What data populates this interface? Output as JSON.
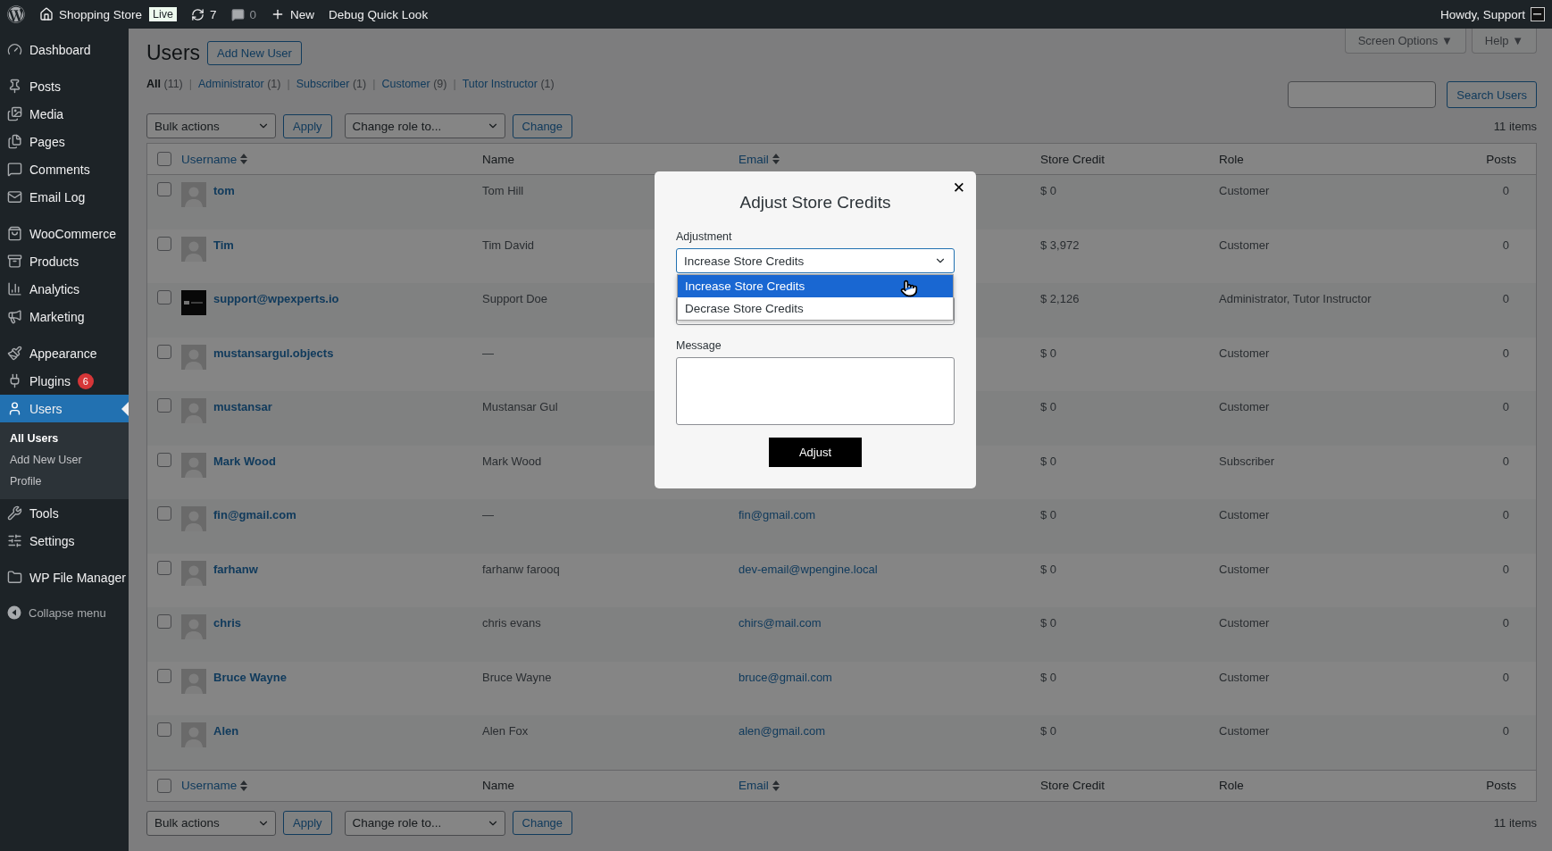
{
  "admin_bar": {
    "site": "Shopping Store",
    "badge": "Live",
    "updates": "7",
    "comments": "0",
    "new": "New",
    "debug": "Debug Quick Look",
    "howdy": "Howdy, Support"
  },
  "sidebar": {
    "groups": [
      [
        {
          "label": "Dashboard",
          "selected": false
        }
      ],
      [
        {
          "label": "Posts",
          "selected": false
        },
        {
          "label": "Media",
          "selected": false
        },
        {
          "label": "Pages",
          "selected": false
        },
        {
          "label": "Comments",
          "selected": false
        },
        {
          "label": "Email Log",
          "selected": false
        }
      ],
      [
        {
          "label": "WooCommerce",
          "selected": false
        },
        {
          "label": "Products",
          "selected": false
        },
        {
          "label": "Analytics",
          "selected": false
        },
        {
          "label": "Marketing",
          "selected": false
        }
      ],
      [
        {
          "label": "Appearance",
          "selected": false
        },
        {
          "label": "Plugins",
          "selected": false,
          "badge": "6"
        },
        {
          "label": "Users",
          "selected": true,
          "children": [
            {
              "label": "All Users",
              "selected": true
            },
            {
              "label": "Add New User",
              "selected": false
            },
            {
              "label": "Profile",
              "selected": false
            }
          ]
        },
        {
          "label": "Tools",
          "selected": false
        },
        {
          "label": "Settings",
          "selected": false
        }
      ],
      [
        {
          "label": "WP File Manager",
          "selected": false
        }
      ]
    ],
    "collapse": "Collapse menu"
  },
  "header": {
    "screen_options": "Screen Options ▼",
    "help": "Help ▼",
    "title": "Users",
    "add_new": "Add New User"
  },
  "filters": [
    {
      "label": "All",
      "count": "(11)",
      "selected": true
    },
    {
      "separator": "|",
      "label": "Administrator",
      "count": "(1)",
      "selected": false
    },
    {
      "separator": "|",
      "label": "Subscriber",
      "count": "(1)",
      "selected": false
    },
    {
      "separator": "|",
      "label": "Customer",
      "count": "(9)",
      "selected": false
    },
    {
      "separator": "|",
      "label": "Tutor Instructor",
      "count": "(1)",
      "selected": false
    }
  ],
  "search_button": "Search Users",
  "bulk_top": {
    "bulk_actions": "Bulk actions",
    "apply": "Apply",
    "change_role": "Change role to...",
    "change": "Change",
    "items": "11 items"
  },
  "table": {
    "select_all_checked": false,
    "columns": [
      "Username",
      "Name",
      "Email",
      "Store Credit",
      "Role",
      "Posts"
    ],
    "rows": [
      {
        "kind": "default",
        "checked": false,
        "username": "tom",
        "name": "Tom Hill",
        "credit": "$ 0",
        "role": "Customer",
        "posts": "0"
      },
      {
        "kind": "default",
        "checked": false,
        "username": "Tim",
        "name": "Tim David",
        "credit": "$ 3,972",
        "role": "Customer",
        "posts": "0"
      },
      {
        "kind": "image",
        "checked": false,
        "username": "support@wpexperts.io",
        "name": "Support Doe",
        "credit": "$ 2,126",
        "role": "Administrator, Tutor Instructor",
        "posts": "0"
      },
      {
        "kind": "default",
        "checked": false,
        "username": "mustansargul.objects",
        "name": "—",
        "credit": "$ 0",
        "role": "Customer",
        "posts": "0"
      },
      {
        "kind": "default",
        "checked": false,
        "username": "mustansar",
        "name": "Mustansar Gul",
        "credit": "$ 0",
        "role": "Customer",
        "posts": "0"
      },
      {
        "kind": "default",
        "checked": false,
        "username": "Mark Wood",
        "name": "Mark Wood",
        "credit": "$ 0",
        "role": "Subscriber",
        "posts": "0"
      },
      {
        "kind": "default",
        "checked": false,
        "username": "fin@gmail.com",
        "name": "—",
        "email": "fin@gmail.com",
        "credit": "$ 0",
        "role": "Customer",
        "posts": "0"
      },
      {
        "kind": "default",
        "checked": false,
        "username": "farhanw",
        "name": "farhanw farooq",
        "email": "dev-email@wpengine.local",
        "credit": "$ 0",
        "role": "Customer",
        "posts": "0"
      },
      {
        "kind": "default",
        "checked": false,
        "username": "chris",
        "name": "chris evans",
        "email": "chirs@mail.com",
        "credit": "$ 0",
        "role": "Customer",
        "posts": "0"
      },
      {
        "kind": "default",
        "checked": false,
        "username": "Bruce Wayne",
        "name": "Bruce Wayne",
        "email": "bruce@gmail.com",
        "credit": "$ 0",
        "role": "Customer",
        "posts": "0"
      },
      {
        "kind": "default",
        "checked": false,
        "username": "Alen",
        "name": "Alen Fox",
        "email": "alen@gmail.com",
        "credit": "$ 0",
        "role": "Customer",
        "posts": "0"
      }
    ],
    "footer_checked": false,
    "footer_columns": [
      "Username",
      "Name",
      "Email",
      "Store Credit",
      "Role",
      "Posts"
    ]
  },
  "bulk_bottom": {
    "bulk_actions": "Bulk actions",
    "apply": "Apply",
    "change_role": "Change role to...",
    "change": "Change",
    "items": "11 items"
  },
  "modal": {
    "title": "Adjust Store Credits",
    "close": "✕",
    "adjustment_label": "Adjustment",
    "adjustment_value": "Increase Store Credits",
    "options": [
      {
        "label": "Increase Store Credits",
        "selected": true
      },
      {
        "label": "Decrase Store Credits",
        "selected": false
      }
    ],
    "message_label": "Message",
    "button": "Adjust"
  }
}
